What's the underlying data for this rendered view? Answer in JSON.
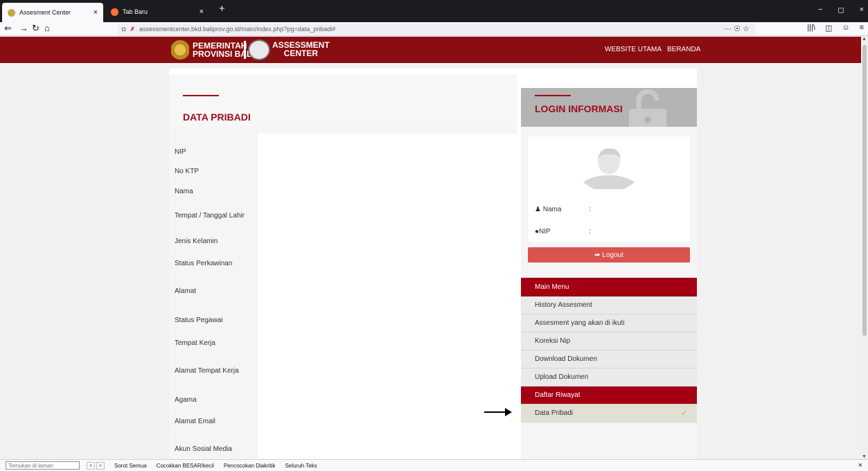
{
  "browser": {
    "tabs": [
      {
        "label": "Assesment Center",
        "close": "×"
      },
      {
        "label": "Tab Baru",
        "close": "×"
      }
    ],
    "new_tab": "+",
    "url": "assessmentcenter.bkd.baliprov.go.id/main/index.php?pg=data_pribadi#",
    "url_actions": "··· ☉ ☆",
    "window_controls": [
      "−",
      "◻",
      "×"
    ],
    "toolbar_icons": [
      "|||\\",
      "◫",
      "☺",
      "≡"
    ]
  },
  "site": {
    "brand_line1": "PEMERINTAH",
    "brand_line2": "PROVINSI BALI",
    "brand2_line1": "ASSESSMENT",
    "brand2_line2": "CENTER",
    "nav": [
      "WEBSITE UTAMA",
      "BERANDA"
    ]
  },
  "data_pribadi": {
    "title": "DATA PRIBADI",
    "fields": [
      "NIP",
      "No KTP",
      "Nama",
      "Tempat / Tanggal Lahir",
      "Jenis Kelamin",
      "Status Perkawinan",
      "Alamat",
      "Status Pegawai",
      "Tempat Kerja",
      "Alamat Tempat Kerja",
      "Agama",
      "Alamat Email",
      "Akun Sosial Media"
    ]
  },
  "login": {
    "title": "LOGIN INFORMASI",
    "name_label": "Nama",
    "nip_label": "NIP",
    "colon": ":",
    "logout_label": "Logout"
  },
  "menu": {
    "header": "Main Menu",
    "items": [
      "History Assesment",
      "Assesment yang akan di ikuti",
      "Koreksi Nip",
      "Download Dokumen",
      "Upload Dokumen",
      "Daftar Riwayat",
      "Data Pribadi"
    ]
  },
  "findbar": {
    "placeholder": "Temukan di laman",
    "options": [
      "Sorot Semua",
      "Cocokkan BESAR/kecil",
      "Pencocokan Diakritik",
      "Seluruh Teks"
    ],
    "close": "×"
  },
  "colors": {
    "brand_red": "#8a0d12",
    "menu_red": "#a30014",
    "logout_red": "#d9534f"
  }
}
